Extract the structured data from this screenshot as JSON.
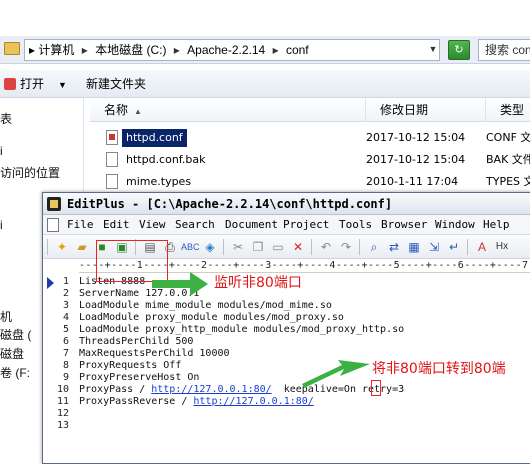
{
  "explorer": {
    "breadcrumb": [
      "计算机",
      "本地磁盘 (C:)",
      "Apache-2.2.14",
      "conf"
    ],
    "search_label": "搜索 conf",
    "commands": {
      "open": "打开",
      "new_folder": "新建文件夹"
    },
    "nav_items": [
      "表",
      "i",
      "访问的位置",
      "i",
      "机",
      "磁盘 (",
      "磁盘",
      "卷 (F:"
    ],
    "columns": {
      "name": "名称",
      "date": "修改日期",
      "type": "类型"
    },
    "files": [
      {
        "name": "httpd.conf",
        "date": "2017-10-12 15:04",
        "type": "CONF 文"
      },
      {
        "name": "httpd.conf.bak",
        "date": "2017-10-12 15:04",
        "type": "BAK 文件"
      },
      {
        "name": "mime.types",
        "date": "2010-1-11 17:04",
        "type": "TYPES 文"
      }
    ]
  },
  "editplus": {
    "title": "EditPlus - [C:\\Apache-2.2.14\\conf\\httpd.conf]",
    "menu": [
      "File",
      "Edit",
      "View",
      "Search",
      "Document",
      "Project",
      "Tools",
      "Browser",
      "Window",
      "Help"
    ],
    "ruler": "----+----1----+----2----+----3----+----4----+----5----+----6----+----7---",
    "lines": [
      {
        "num": "1",
        "pre": "Listen 8888",
        "link": "",
        "post": ""
      },
      {
        "num": "2",
        "pre": "ServerName 127.0.0.1",
        "link": "",
        "post": ""
      },
      {
        "num": "3",
        "pre": "LoadModule mime_module modules/mod_mime.so",
        "link": "",
        "post": ""
      },
      {
        "num": "4",
        "pre": "LoadModule proxy_module modules/mod_proxy.so",
        "link": "",
        "post": ""
      },
      {
        "num": "5",
        "pre": "LoadModule proxy_http_module modules/mod_proxy_http.so",
        "link": "",
        "post": ""
      },
      {
        "num": "6",
        "pre": "ThreadsPerChild 500",
        "link": "",
        "post": ""
      },
      {
        "num": "7",
        "pre": "MaxRequestsPerChild 10000",
        "link": "",
        "post": ""
      },
      {
        "num": "8",
        "pre": "ProxyRequests Off",
        "link": "",
        "post": ""
      },
      {
        "num": "9",
        "pre": "ProxyPreserveHost On",
        "link": "",
        "post": ""
      },
      {
        "num": "10",
        "pre": "ProxyPass / ",
        "link": "http://127.0.0.1:80/",
        "post": "  keepalive=On retry=3"
      },
      {
        "num": "11",
        "pre": "ProxyPassReverse / ",
        "link": "http://127.0.0.1:80/",
        "post": ""
      },
      {
        "num": "12",
        "pre": "",
        "link": "",
        "post": ""
      },
      {
        "num": "13",
        "pre": "",
        "link": "",
        "post": ""
      }
    ]
  },
  "annotations": {
    "note1": "监听非80端口",
    "note2": "将非80端口转到80端"
  },
  "colors": {
    "annotation": "#e01515",
    "arrow": "#3cb043",
    "selection": "#0a246a",
    "link": "#1a3fd0"
  }
}
